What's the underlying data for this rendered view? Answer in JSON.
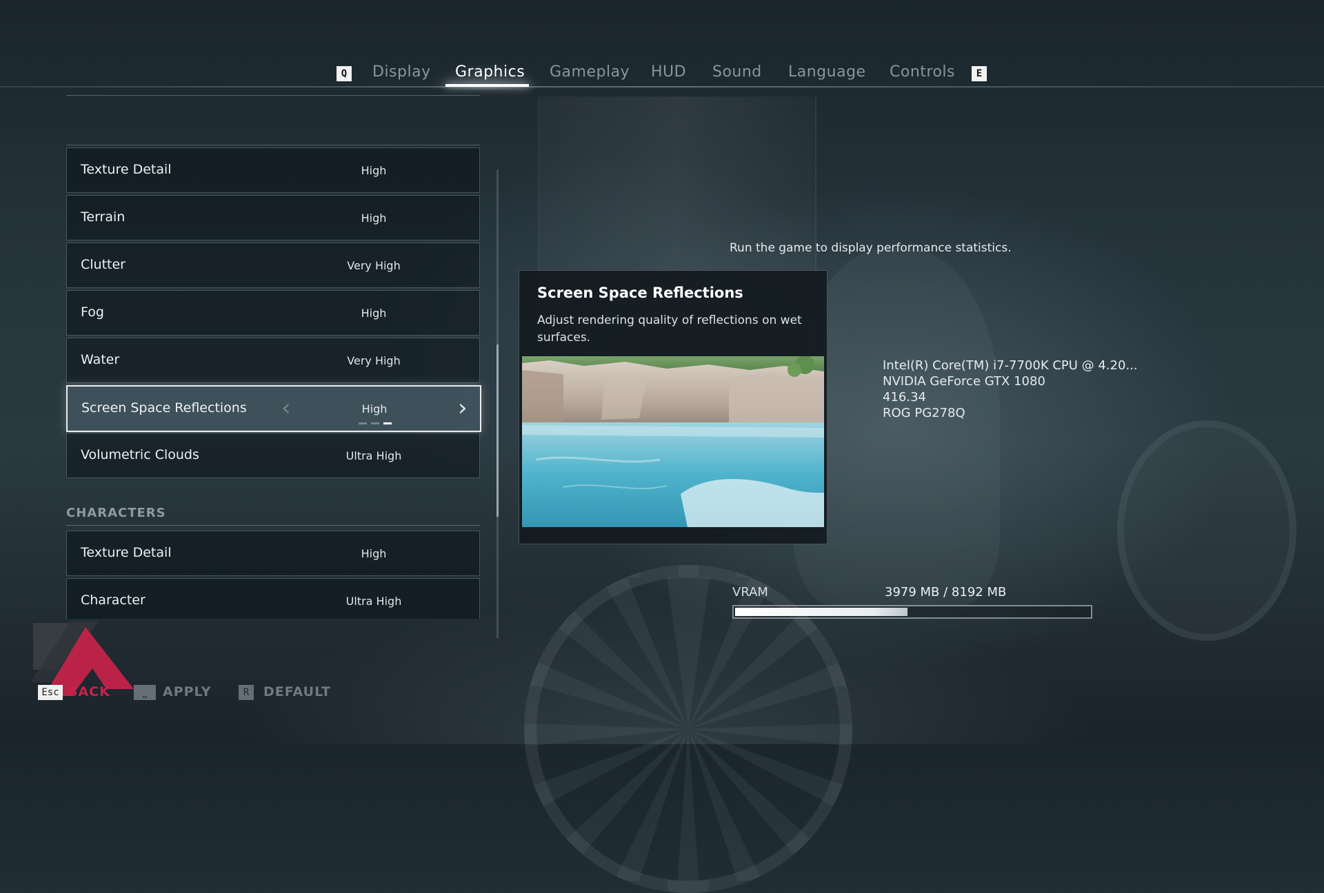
{
  "tabs": {
    "prev_key": "Q",
    "next_key": "E",
    "items": [
      "Display",
      "Graphics",
      "Gameplay",
      "HUD",
      "Sound",
      "Language",
      "Controls"
    ],
    "active": "Graphics"
  },
  "settings": {
    "world_rows": [
      {
        "label": "Texture Detail",
        "value": "High"
      },
      {
        "label": "Terrain",
        "value": "High"
      },
      {
        "label": "Clutter",
        "value": "Very High"
      },
      {
        "label": "Fog",
        "value": "High"
      },
      {
        "label": "Water",
        "value": "Very High"
      },
      {
        "label": "Screen Space Reflections",
        "value": "High",
        "selected": true,
        "option_index": 3,
        "option_count": 3
      },
      {
        "label": "Volumetric Clouds",
        "value": "Ultra High"
      }
    ],
    "characters_header": "CHARACTERS",
    "character_rows": [
      {
        "label": "Texture Detail",
        "value": "High"
      },
      {
        "label": "Character",
        "value": "Ultra High"
      }
    ]
  },
  "info_panel": {
    "title": "Screen Space Reflections",
    "description": "Adjust rendering quality of reflections on wet surfaces."
  },
  "performance": {
    "message": "Run the game to display performance statistics."
  },
  "system": {
    "cpu": "Intel(R) Core(TM) i7-7700K CPU @ 4.20...",
    "gpu": "NVIDIA GeForce GTX 1080",
    "driver": "416.34",
    "monitor": "ROG PG278Q"
  },
  "vram": {
    "label": "VRAM",
    "text": "3979 MB / 8192 MB",
    "used_fraction": 0.4857
  },
  "footer": {
    "back_key": "Esc",
    "back_label": "BACK",
    "apply_label": "APPLY",
    "default_key": "R",
    "default_label": "DEFAULT"
  },
  "colors": {
    "accent_back": "#c8234a",
    "active_tab": "#ffffff",
    "inactive_tab": "#8a969c"
  }
}
